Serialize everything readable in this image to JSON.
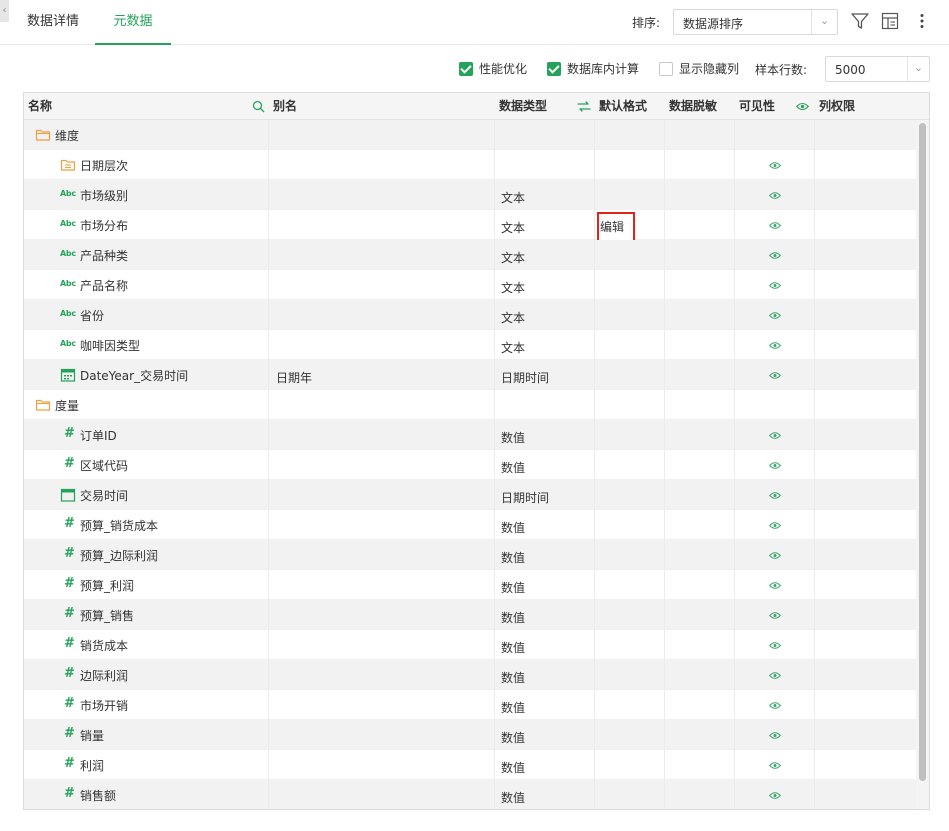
{
  "tabs": [
    {
      "label": "数据详情",
      "active": false
    },
    {
      "label": "元数据",
      "active": true
    }
  ],
  "toolbar": {
    "sort_label": "排序:",
    "sort_value": "数据源排序",
    "icons": [
      "filter-icon",
      "column-settings-icon",
      "more-vertical-icon"
    ]
  },
  "options": {
    "perf_opt": {
      "label": "性能优化",
      "checked": true
    },
    "db_calc": {
      "label": "数据库内计算",
      "checked": true
    },
    "show_hidden": {
      "label": "显示隐藏列",
      "checked": false
    },
    "rows_label": "样本行数:",
    "rows_value": "5000"
  },
  "columns": {
    "name": "名称",
    "alias": "别名",
    "type": "数据类型",
    "format": "默认格式",
    "mask": "数据脱敏",
    "visibility": "可见性",
    "permission": "列权限"
  },
  "edit_label": "编辑",
  "rows": [
    {
      "kind": "folder",
      "name": "维度",
      "alias": "",
      "type": ""
    },
    {
      "kind": "hierarchy",
      "name": "日期层次",
      "alias": "",
      "type": "",
      "visible": true
    },
    {
      "kind": "text",
      "name": "市场级别",
      "alias": "",
      "type": "文本",
      "visible": true
    },
    {
      "kind": "text",
      "name": "市场分布",
      "alias": "",
      "type": "文本",
      "visible": true,
      "editing": true
    },
    {
      "kind": "text",
      "name": "产品种类",
      "alias": "",
      "type": "文本",
      "visible": true
    },
    {
      "kind": "text",
      "name": "产品名称",
      "alias": "",
      "type": "文本",
      "visible": true
    },
    {
      "kind": "text",
      "name": "省份",
      "alias": "",
      "type": "文本",
      "visible": true
    },
    {
      "kind": "text",
      "name": "咖啡因类型",
      "alias": "",
      "type": "文本",
      "visible": true
    },
    {
      "kind": "date",
      "name": "DateYear_交易时间",
      "alias": "日期年",
      "type": "日期时间",
      "visible": true
    },
    {
      "kind": "folder",
      "name": "度量",
      "alias": "",
      "type": ""
    },
    {
      "kind": "number",
      "name": "订单ID",
      "alias": "",
      "type": "数值",
      "visible": true
    },
    {
      "kind": "number",
      "name": "区域代码",
      "alias": "",
      "type": "数值",
      "visible": true
    },
    {
      "kind": "datetime",
      "name": "交易时间",
      "alias": "",
      "type": "日期时间",
      "visible": true
    },
    {
      "kind": "number",
      "name": "预算_销货成本",
      "alias": "",
      "type": "数值",
      "visible": true
    },
    {
      "kind": "number",
      "name": "预算_边际利润",
      "alias": "",
      "type": "数值",
      "visible": true
    },
    {
      "kind": "number",
      "name": "预算_利润",
      "alias": "",
      "type": "数值",
      "visible": true
    },
    {
      "kind": "number",
      "name": "预算_销售",
      "alias": "",
      "type": "数值",
      "visible": true
    },
    {
      "kind": "number",
      "name": "销货成本",
      "alias": "",
      "type": "数值",
      "visible": true
    },
    {
      "kind": "number",
      "name": "边际利润",
      "alias": "",
      "type": "数值",
      "visible": true
    },
    {
      "kind": "number",
      "name": "市场开销",
      "alias": "",
      "type": "数值",
      "visible": true
    },
    {
      "kind": "number",
      "name": "销量",
      "alias": "",
      "type": "数值",
      "visible": true
    },
    {
      "kind": "number",
      "name": "利润",
      "alias": "",
      "type": "数值",
      "visible": true
    },
    {
      "kind": "number",
      "name": "销售额",
      "alias": "",
      "type": "数值",
      "visible": true
    }
  ],
  "colors": {
    "accent": "#25a35a",
    "highlight_border": "#e0241b",
    "folder": "#f0a040"
  }
}
